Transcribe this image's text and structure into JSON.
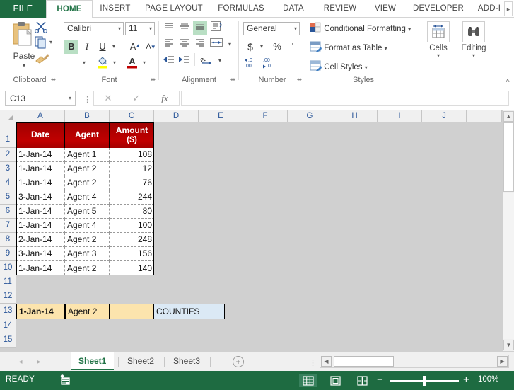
{
  "tabs": {
    "file": "FILE",
    "items": [
      {
        "label": "HOME",
        "active": true
      },
      {
        "label": "INSERT",
        "active": false
      },
      {
        "label": "PAGE LAYOUT",
        "active": false
      },
      {
        "label": "FORMULAS",
        "active": false
      },
      {
        "label": "DATA",
        "active": false
      },
      {
        "label": "REVIEW",
        "active": false
      },
      {
        "label": "VIEW",
        "active": false
      },
      {
        "label": "DEVELOPER",
        "active": false
      },
      {
        "label": "ADD-I",
        "active": false
      }
    ],
    "overflow": "▸"
  },
  "ribbon": {
    "groups": {
      "clipboard": "Clipboard",
      "font": "Font",
      "alignment": "Alignment",
      "number": "Number",
      "styles": "Styles",
      "cells": "Cells",
      "editing": "Editing"
    },
    "paste": {
      "label": "Paste",
      "caret": "▾"
    },
    "font": {
      "name": "Calibri",
      "size": "11",
      "bold": "B",
      "italic": "I",
      "underline": "U",
      "grow": "A",
      "shrink": "A",
      "caret": "▾"
    },
    "number": {
      "format": "General",
      "currency": "$",
      "percent": "%",
      "comma": "'",
      "inc_dec": ".00",
      "dec_dec": ".00",
      "caret": "▾"
    },
    "styles": {
      "conditional_formatting": "Conditional Formatting",
      "format_as_table": "Format as Table",
      "cell_styles": "Cell Styles",
      "caret": "▾"
    },
    "cells": {
      "label": "Cells",
      "caret": "▾"
    },
    "editing": {
      "label": "Editing",
      "caret": "▾"
    },
    "collapse": "˄",
    "dialog_launcher": "⬌"
  },
  "formula_bar": {
    "name_box": "C13",
    "name_caret": "▾",
    "cancel": "✕",
    "enter": "✓",
    "fx": "fx",
    "formula": "",
    "formula_placeholder": ""
  },
  "grid": {
    "columns": [
      "A",
      "B",
      "C",
      "D",
      "E",
      "F",
      "G",
      "H",
      "I",
      "J"
    ],
    "rows": [
      "1",
      "2",
      "3",
      "4",
      "5",
      "6",
      "7",
      "8",
      "9",
      "10",
      "11",
      "12",
      "13",
      "14",
      "15"
    ],
    "headers": {
      "date": "Date",
      "agent": "Agent",
      "amount": "Amount ($)"
    },
    "data": [
      {
        "row": "2",
        "date": "1-Jan-14",
        "agent": "Agent 1",
        "amount": "108"
      },
      {
        "row": "3",
        "date": "1-Jan-14",
        "agent": "Agent 2",
        "amount": "12"
      },
      {
        "row": "4",
        "date": "1-Jan-14",
        "agent": "Agent 2",
        "amount": "76"
      },
      {
        "row": "5",
        "date": "3-Jan-14",
        "agent": "Agent 4",
        "amount": "244"
      },
      {
        "row": "6",
        "date": "1-Jan-14",
        "agent": "Agent 5",
        "amount": "80"
      },
      {
        "row": "7",
        "date": "1-Jan-14",
        "agent": "Agent 4",
        "amount": "100"
      },
      {
        "row": "8",
        "date": "2-Jan-14",
        "agent": "Agent 2",
        "amount": "248"
      },
      {
        "row": "9",
        "date": "3-Jan-14",
        "agent": "Agent 3",
        "amount": "156"
      },
      {
        "row": "10",
        "date": "1-Jan-14",
        "agent": "Agent 2",
        "amount": "140"
      }
    ],
    "criteria_row": {
      "row": "13",
      "date": "1-Jan-14",
      "agent": "Agent 2",
      "result": "",
      "label": "COUNTIFS"
    },
    "colors": {
      "header_fill": "#c00000",
      "criteria_fill": "#fce4ad",
      "label_fill": "#dbe9f5"
    }
  },
  "sheet_tabs": {
    "prev": "◂",
    "next": "▸",
    "items": [
      {
        "label": "Sheet1",
        "active": true
      },
      {
        "label": "Sheet2",
        "active": false
      },
      {
        "label": "Sheet3",
        "active": false
      }
    ],
    "add": "+"
  },
  "status_bar": {
    "mode": "READY",
    "macro_icon": "record-macro-icon",
    "views": [
      {
        "name": "normal-view",
        "active": true
      },
      {
        "name": "page-layout-view",
        "active": false
      },
      {
        "name": "page-break-preview",
        "active": false
      }
    ],
    "zoom_out": "−",
    "zoom_in": "+",
    "zoom_level": "100%"
  }
}
